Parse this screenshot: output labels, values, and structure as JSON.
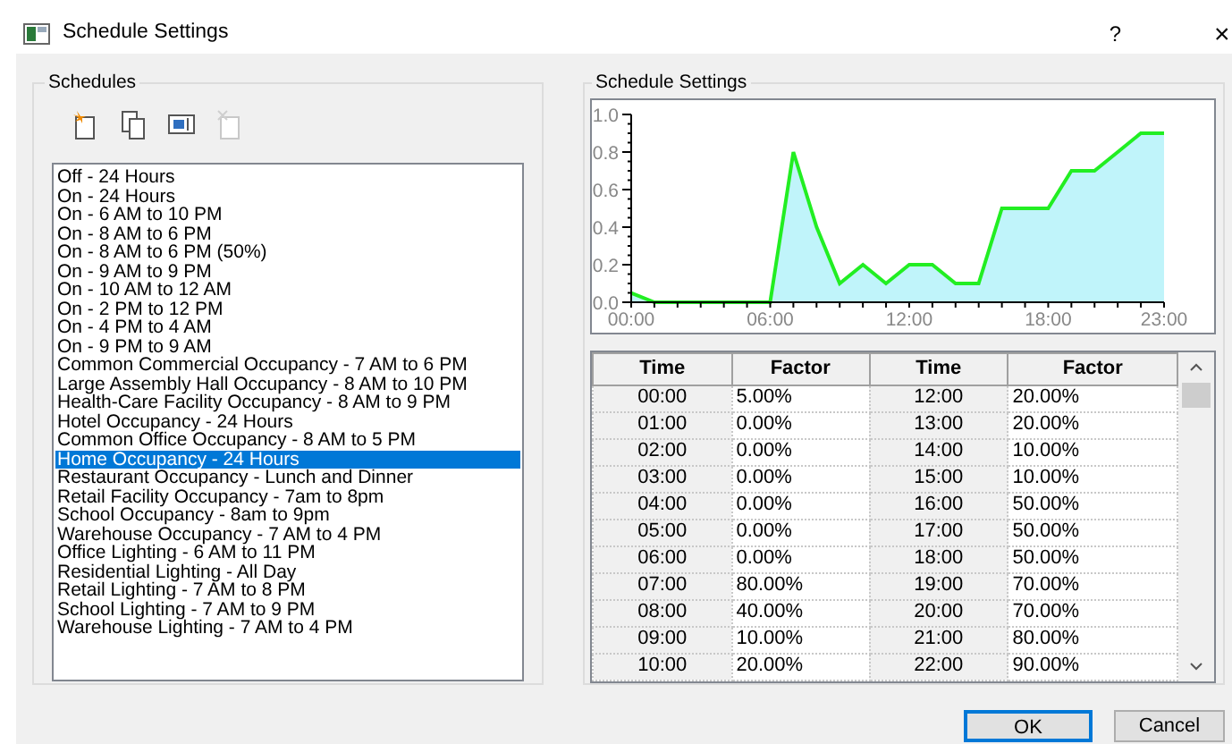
{
  "window": {
    "title": "Schedule Settings",
    "help": "?",
    "close": "×"
  },
  "schedules": {
    "title": "Schedules",
    "toolbar": [
      {
        "kind": "new",
        "disabled": false
      },
      {
        "kind": "copy",
        "disabled": false
      },
      {
        "kind": "rename",
        "disabled": false
      },
      {
        "kind": "delete",
        "disabled": true
      }
    ],
    "items": [
      {
        "label": "Off - 24 Hours",
        "selected": false
      },
      {
        "label": "On - 24 Hours",
        "selected": false
      },
      {
        "label": "On - 6 AM to 10 PM",
        "selected": false
      },
      {
        "label": "On - 8 AM to 6 PM",
        "selected": false
      },
      {
        "label": "On - 8 AM to 6 PM (50%)",
        "selected": false
      },
      {
        "label": "On - 9 AM to 9 PM",
        "selected": false
      },
      {
        "label": "On - 10 AM to 12 AM",
        "selected": false
      },
      {
        "label": "On - 2 PM to 12 PM",
        "selected": false
      },
      {
        "label": "On - 4 PM to 4 AM",
        "selected": false
      },
      {
        "label": "On - 9 PM to 9 AM",
        "selected": false
      },
      {
        "label": "Common Commercial Occupancy - 7 AM to 6 PM",
        "selected": false
      },
      {
        "label": "Large Assembly Hall Occupancy - 8 AM to 10 PM",
        "selected": false
      },
      {
        "label": "Health-Care Facility Occupancy - 8 AM to 9 PM",
        "selected": false
      },
      {
        "label": "Hotel Occupancy - 24 Hours",
        "selected": false
      },
      {
        "label": "Common Office Occupancy - 8 AM to 5 PM",
        "selected": false
      },
      {
        "label": "Home Occupancy - 24 Hours",
        "selected": true
      },
      {
        "label": "Restaurant Occupancy - Lunch and Dinner",
        "selected": false
      },
      {
        "label": "Retail Facility Occupancy - 7am to 8pm",
        "selected": false
      },
      {
        "label": "School Occupancy - 8am to 9pm",
        "selected": false
      },
      {
        "label": "Warehouse Occupancy - 7 AM to 4 PM",
        "selected": false
      },
      {
        "label": "Office Lighting - 6 AM to 11 PM",
        "selected": false
      },
      {
        "label": "Residential Lighting - All Day",
        "selected": false
      },
      {
        "label": "Retail Lighting - 7 AM to 8 PM",
        "selected": false
      },
      {
        "label": "School Lighting - 7 AM to 9 PM",
        "selected": false
      },
      {
        "label": "Warehouse Lighting - 7 AM to 4 PM",
        "selected": false
      }
    ]
  },
  "settings": {
    "title": "Schedule Settings",
    "chart_data": {
      "type": "area",
      "x": [
        0,
        1,
        2,
        3,
        4,
        5,
        6,
        7,
        8,
        9,
        10,
        11,
        12,
        13,
        14,
        15,
        16,
        17,
        18,
        19,
        20,
        21,
        22,
        23
      ],
      "series": [
        {
          "color": "#22ee22",
          "values": [
            0.05,
            0,
            0,
            0,
            0,
            0,
            0,
            0.8,
            0.4,
            0.1,
            0.2,
            0.1,
            0.2,
            0.2,
            0.1,
            0.1,
            0.5,
            0.5,
            0.5,
            0.7,
            0.7,
            0.8,
            0.9,
            0.9
          ]
        }
      ],
      "xlim": [
        0,
        23
      ],
      "ylim": [
        0,
        1
      ],
      "xticks": [
        {
          "value": 0,
          "label": "00:00"
        },
        {
          "value": 6,
          "label": "06:00"
        },
        {
          "value": 12,
          "label": "12:00"
        },
        {
          "value": 18,
          "label": "18:00"
        },
        {
          "value": 23,
          "label": "23:00"
        }
      ],
      "yticks": [
        {
          "value": 0,
          "label": "0.0"
        },
        {
          "value": 0.2,
          "label": "0.2"
        },
        {
          "value": 0.4,
          "label": "0.4"
        },
        {
          "value": 0.6,
          "label": "0.6"
        },
        {
          "value": 0.8,
          "label": "0.8"
        },
        {
          "value": 1,
          "label": "1.0"
        }
      ]
    },
    "table": {
      "columns": [
        "Time",
        "Factor",
        "Time",
        "Factor"
      ],
      "rows": [
        [
          "00:00",
          "5.00%",
          "12:00",
          "20.00%"
        ],
        [
          "01:00",
          "0.00%",
          "13:00",
          "20.00%"
        ],
        [
          "02:00",
          "0.00%",
          "14:00",
          "10.00%"
        ],
        [
          "03:00",
          "0.00%",
          "15:00",
          "10.00%"
        ],
        [
          "04:00",
          "0.00%",
          "16:00",
          "50.00%"
        ],
        [
          "05:00",
          "0.00%",
          "17:00",
          "50.00%"
        ],
        [
          "06:00",
          "0.00%",
          "18:00",
          "50.00%"
        ],
        [
          "07:00",
          "80.00%",
          "19:00",
          "70.00%"
        ],
        [
          "08:00",
          "40.00%",
          "20:00",
          "70.00%"
        ],
        [
          "09:00",
          "10.00%",
          "21:00",
          "80.00%"
        ],
        [
          "10:00",
          "20.00%",
          "22:00",
          "90.00%"
        ]
      ]
    }
  },
  "buttons": [
    {
      "label": "OK",
      "focused": true
    },
    {
      "label": "Cancel",
      "focused": false
    }
  ]
}
